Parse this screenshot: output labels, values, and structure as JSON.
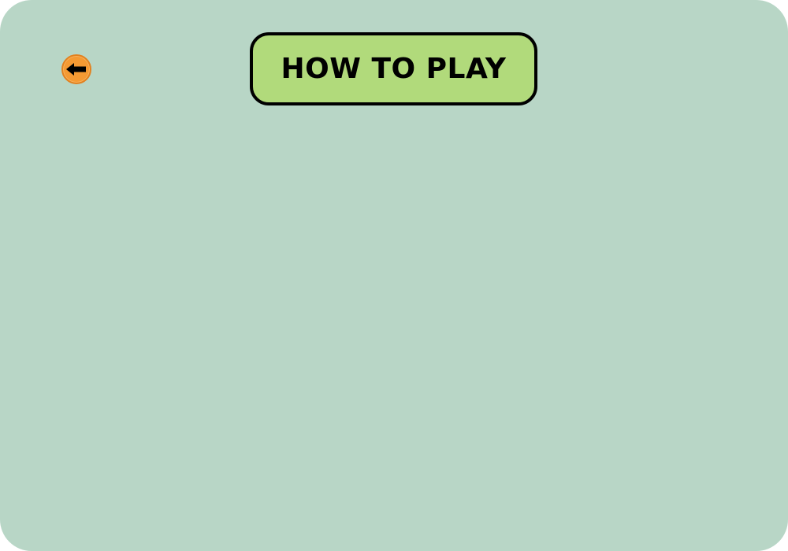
{
  "screen": {
    "title": "HOW TO PLAY",
    "background_color": "#b8d6c6"
  },
  "back_button": {
    "icon": "arrow-left-icon",
    "color": "#f59a33",
    "arrow_color": "#000000"
  },
  "title_badge": {
    "fill_color": "#b1da7b",
    "border_color": "#000000"
  }
}
